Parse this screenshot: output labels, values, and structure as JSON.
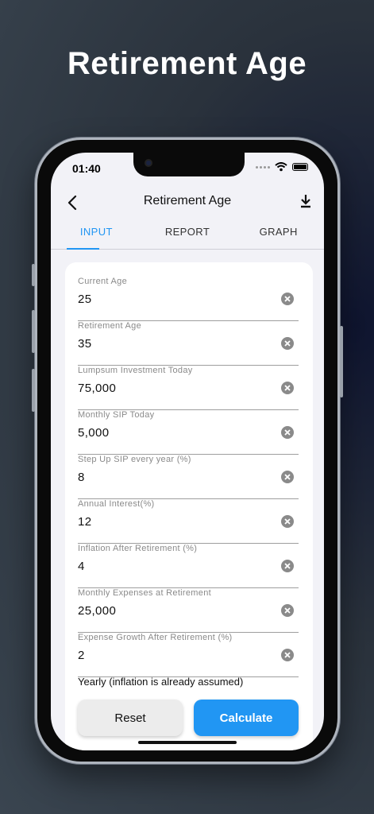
{
  "headline": "Retirement Age",
  "status_bar": {
    "time": "01:40"
  },
  "app_bar": {
    "title": "Retirement Age"
  },
  "tabs": [
    {
      "label": "INPUT",
      "active": true
    },
    {
      "label": "REPORT",
      "active": false
    },
    {
      "label": "GRAPH",
      "active": false
    }
  ],
  "fields": [
    {
      "label": "Current Age",
      "value": "25"
    },
    {
      "label": "Retirement Age",
      "value": "35"
    },
    {
      "label": "Lumpsum Investment Today",
      "value": "75,000"
    },
    {
      "label": "Monthly SIP Today",
      "value": "5,000"
    },
    {
      "label": "Step Up SIP every year (%)",
      "value": "8"
    },
    {
      "label": "Annual Interest(%)",
      "value": "12"
    },
    {
      "label": "Inflation After Retirement (%)",
      "value": "4"
    },
    {
      "label": "Monthly Expenses at Retirement",
      "value": "25,000"
    },
    {
      "label": "Expense Growth After Retirement (%)",
      "value": "2"
    }
  ],
  "note": "Yearly (inflation is already assumed)",
  "buttons": {
    "reset": "Reset",
    "calculate": "Calculate"
  },
  "colors": {
    "accent": "#2196f3",
    "screen_bg": "#f2f2f7",
    "card_bg": "#ffffff",
    "reset_bg": "#ececec"
  }
}
